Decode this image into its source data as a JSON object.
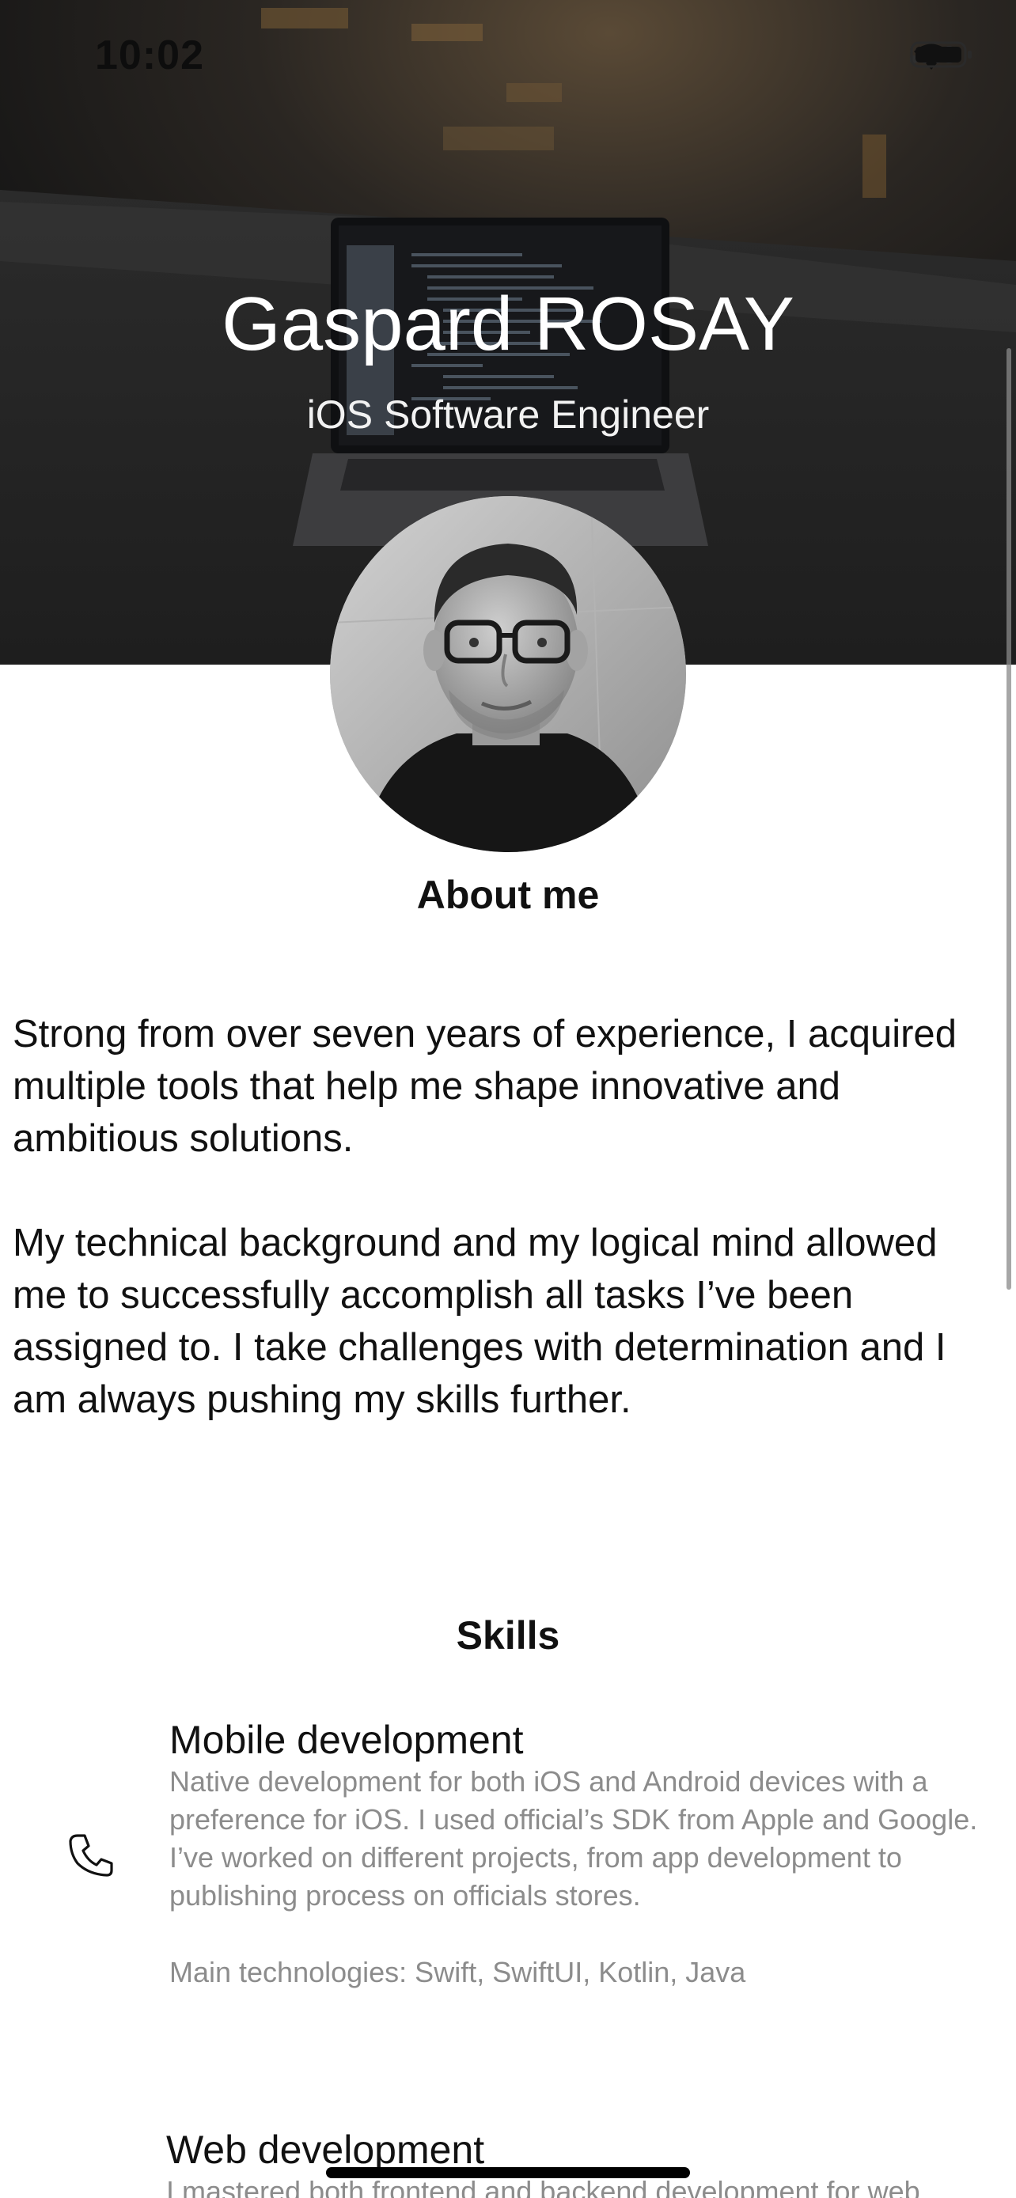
{
  "status_bar": {
    "time": "10:02",
    "icons": [
      "cellular-signal-icon",
      "wifi-icon",
      "battery-icon"
    ]
  },
  "header": {
    "name": "Gaspard ROSAY",
    "role": "iOS Software Engineer"
  },
  "about": {
    "title": "About me",
    "paragraphs": [
      "Strong from over seven years of experience, I acquired multiple tools that help me shape innovative and ambitious solutions.",
      "My technical background and my logical mind allowed me to successfully accomplish all tasks I’ve been assigned to. I take challenges with determination and I am always pushing my skills further."
    ]
  },
  "skills": {
    "title": "Skills",
    "items": [
      {
        "icon": "phone-icon",
        "title": "Mobile development",
        "description": "Native development for both iOS and Android devices with a preference for iOS. I used official’s SDK from Apple and Google. I’ve worked on different projects, from app development to publishing process on officials stores.",
        "technologies": "Main technologies: Swift, SwiftUI, Kotlin, Java"
      },
      {
        "title": "Web development",
        "description": "I mastered both frontend and backend development for web"
      }
    ]
  },
  "colors": {
    "hero_background": "#1b1b1b",
    "text_primary": "#111111",
    "text_secondary": "#8c8c8c",
    "background": "#ffffff"
  }
}
